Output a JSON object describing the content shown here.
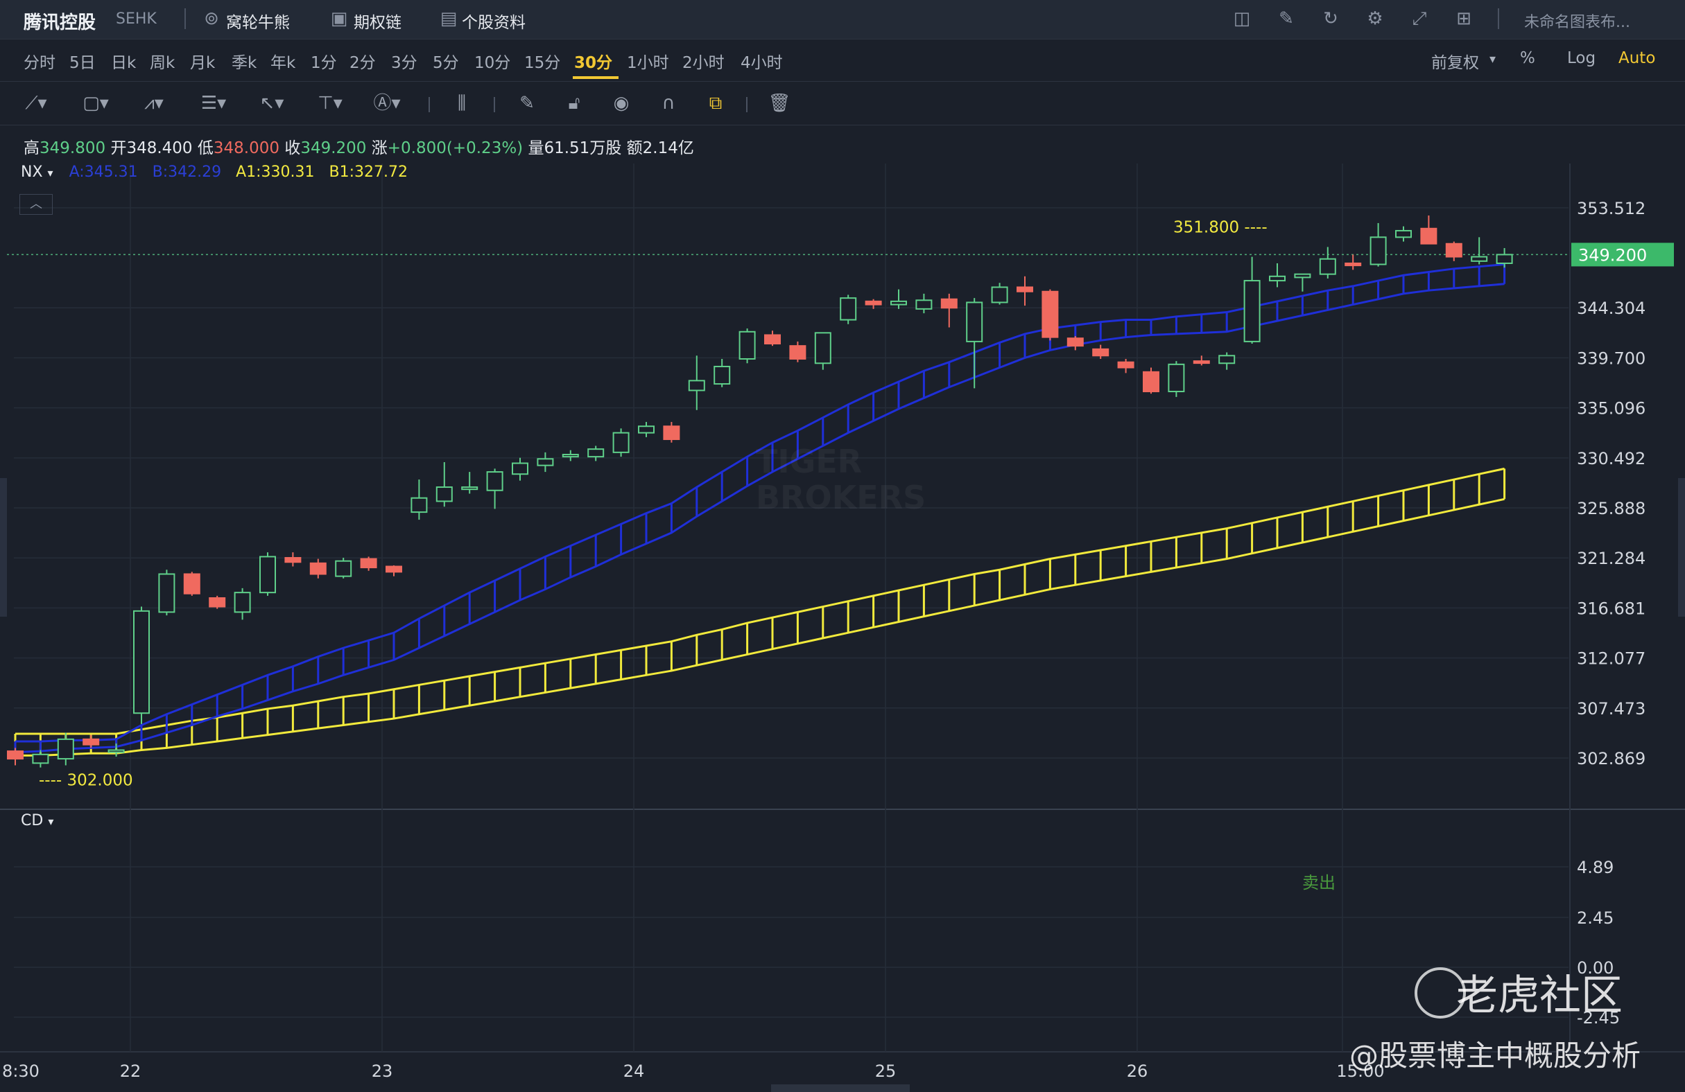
{
  "header": {
    "stock_name": "腾讯控股",
    "exchange": "SEHK",
    "items": [
      "窝轮牛熊",
      "期权链",
      "个股资料"
    ],
    "right_label": "未命名图表布..."
  },
  "periods": [
    "分时",
    "5日",
    "日k",
    "周k",
    "月k",
    "季k",
    "年k",
    "1分",
    "2分",
    "3分",
    "5分",
    "10分",
    "15分",
    "30分",
    "1小时",
    "2小时",
    "4小时"
  ],
  "active_period": "30分",
  "right_controls": {
    "adjust": "前复权",
    "percent": "%",
    "log": "Log",
    "auto": "Auto"
  },
  "quote": {
    "high_label": "高",
    "high": "349.800",
    "open_label": "开",
    "open": "348.400",
    "low_label": "低",
    "low": "348.000",
    "close_label": "收",
    "close": "349.200",
    "change_label": "涨",
    "change": "+0.800(+0.23%)",
    "volume_label": "量",
    "volume": "61.51万股",
    "amount_label": "额",
    "amount": "2.14亿"
  },
  "indicator": {
    "name": "NX",
    "a": "A:345.31",
    "b": "B:342.29",
    "a1": "A1:330.31",
    "b1": "B1:327.72"
  },
  "sub_indicator": {
    "name": "CD",
    "signal": "卖出"
  },
  "watermark": {
    "logo": "老虎社区",
    "author": "@股票博主中概股分析",
    "brand": "TIGER BROKERS"
  },
  "colors": {
    "up": "#5fd08a",
    "down": "#f06a5f",
    "band_ab": "#1f2fd8",
    "band_a1b1": "#f2ea3c",
    "last_price_bg": "#3cb96a",
    "accent": "#f2c833"
  },
  "chart_data": {
    "type": "candlestick",
    "last_price": "349.200",
    "high_annotation": "351.800",
    "low_annotation": "302.000",
    "y_ticks": [
      "353.512",
      "349.200",
      "344.304",
      "339.700",
      "335.096",
      "330.492",
      "325.888",
      "321.284",
      "316.681",
      "312.077",
      "307.473",
      "302.869"
    ],
    "x_ticks": [
      "8:30",
      "22",
      "23",
      "24",
      "25",
      "26",
      "15:00"
    ],
    "sub_y_ticks": [
      "4.89",
      "2.45",
      "0.00",
      "-2.45"
    ],
    "candles": [
      [
        303.5,
        303.8,
        302.2,
        302.8
      ],
      [
        302.4,
        303.6,
        302.0,
        303.2
      ],
      [
        302.8,
        305.2,
        302.2,
        304.6
      ],
      [
        304.6,
        305.0,
        303.8,
        304.1
      ],
      [
        303.4,
        304.2,
        303.0,
        303.6
      ],
      [
        307.0,
        316.8,
        306.0,
        316.4
      ],
      [
        316.3,
        320.2,
        316.0,
        319.8
      ],
      [
        319.8,
        320.0,
        317.8,
        318.0
      ],
      [
        317.6,
        317.8,
        316.6,
        316.8
      ],
      [
        316.3,
        318.5,
        315.6,
        318.1
      ],
      [
        318.1,
        321.8,
        317.8,
        321.4
      ],
      [
        321.3,
        321.8,
        320.5,
        320.9
      ],
      [
        320.8,
        321.2,
        319.4,
        319.8
      ],
      [
        319.6,
        321.3,
        319.4,
        321.0
      ],
      [
        321.2,
        321.4,
        320.1,
        320.4
      ],
      [
        320.5,
        320.6,
        319.6,
        320.0
      ],
      [
        325.5,
        328.5,
        324.8,
        326.8
      ],
      [
        326.5,
        330.1,
        326.0,
        327.8
      ],
      [
        327.6,
        329.2,
        327.2,
        327.8
      ],
      [
        327.5,
        329.5,
        325.8,
        329.2
      ],
      [
        329.0,
        330.5,
        328.4,
        330.0
      ],
      [
        329.8,
        331.0,
        329.2,
        330.4
      ],
      [
        330.6,
        331.2,
        330.2,
        330.8
      ],
      [
        330.6,
        331.6,
        330.2,
        331.3
      ],
      [
        331.0,
        333.2,
        330.6,
        332.8
      ],
      [
        332.8,
        333.8,
        332.4,
        333.4
      ],
      [
        333.4,
        333.8,
        331.9,
        332.2
      ],
      [
        336.7,
        339.9,
        334.9,
        337.6
      ],
      [
        337.3,
        339.6,
        337.0,
        338.9
      ],
      [
        339.6,
        342.4,
        339.2,
        342.1
      ],
      [
        341.8,
        342.2,
        340.8,
        341.0
      ],
      [
        340.8,
        341.2,
        339.3,
        339.6
      ],
      [
        339.2,
        342.0,
        338.6,
        342.0
      ],
      [
        343.2,
        345.5,
        342.8,
        345.2
      ],
      [
        344.9,
        345.1,
        344.2,
        344.6
      ],
      [
        344.6,
        346.0,
        344.2,
        344.9
      ],
      [
        344.2,
        345.6,
        343.8,
        345.0
      ],
      [
        345.1,
        345.6,
        342.5,
        344.3
      ],
      [
        341.2,
        345.2,
        336.9,
        344.8
      ],
      [
        344.8,
        346.6,
        344.6,
        346.2
      ],
      [
        346.2,
        347.2,
        344.5,
        345.8
      ],
      [
        345.8,
        346.0,
        341.3,
        341.6
      ],
      [
        341.5,
        341.7,
        340.4,
        340.8
      ],
      [
        340.5,
        340.9,
        339.6,
        339.9
      ],
      [
        339.3,
        339.6,
        338.3,
        338.8
      ],
      [
        338.4,
        338.8,
        336.4,
        336.6
      ],
      [
        336.6,
        339.4,
        336.1,
        339.1
      ],
      [
        339.4,
        339.9,
        339.0,
        339.3
      ],
      [
        339.2,
        340.2,
        338.6,
        339.9
      ],
      [
        341.2,
        349.0,
        341.0,
        346.8
      ],
      [
        346.8,
        348.4,
        346.2,
        347.2
      ],
      [
        347.1,
        347.4,
        345.8,
        347.4
      ],
      [
        347.4,
        349.9,
        347.0,
        348.8
      ],
      [
        348.4,
        349.2,
        347.8,
        348.2
      ],
      [
        348.3,
        352.1,
        348.1,
        350.8
      ],
      [
        350.8,
        351.8,
        350.4,
        351.4
      ],
      [
        351.6,
        352.8,
        350.4,
        350.2
      ],
      [
        350.2,
        350.4,
        348.6,
        349.0
      ],
      [
        348.6,
        350.8,
        348.3,
        349.0
      ],
      [
        348.4,
        349.8,
        348.0,
        349.2
      ]
    ],
    "series": [
      {
        "name": "A",
        "values": [
          304.4,
          304.4,
          304.5,
          304.5,
          304.6,
          305.9,
          306.9,
          307.8,
          308.7,
          309.6,
          310.5,
          311.3,
          312.2,
          313.0,
          313.7,
          314.4,
          315.7,
          316.9,
          318.1,
          319.2,
          320.3,
          321.4,
          322.4,
          323.4,
          324.4,
          325.4,
          326.3,
          327.8,
          329.2,
          330.6,
          331.9,
          333.0,
          334.2,
          335.4,
          336.5,
          337.5,
          338.5,
          339.3,
          340.2,
          341.1,
          341.9,
          342.4,
          342.7,
          343.0,
          343.2,
          343.2,
          343.5,
          343.7,
          343.9,
          344.4,
          344.9,
          345.4,
          345.9,
          346.3,
          346.8,
          347.3,
          347.6,
          347.9,
          348.1,
          348.3
        ]
      },
      {
        "name": "B",
        "values": [
          303.4,
          303.5,
          303.7,
          303.8,
          303.9,
          304.5,
          305.2,
          305.9,
          306.7,
          307.4,
          308.2,
          309.0,
          309.7,
          310.5,
          311.2,
          311.9,
          313.0,
          314.1,
          315.2,
          316.3,
          317.4,
          318.4,
          319.5,
          320.5,
          321.6,
          322.6,
          323.6,
          325.1,
          326.5,
          327.9,
          329.2,
          330.4,
          331.6,
          332.8,
          333.9,
          335.0,
          336.0,
          337.0,
          337.9,
          338.8,
          339.7,
          340.4,
          340.9,
          341.3,
          341.6,
          341.8,
          341.9,
          342.0,
          342.1,
          342.6,
          343.1,
          343.6,
          344.1,
          344.6,
          345.1,
          345.6,
          345.9,
          346.1,
          346.3,
          346.5
        ]
      },
      {
        "name": "A1",
        "values": [
          305.1,
          305.1,
          305.1,
          305.1,
          305.1,
          305.5,
          305.9,
          306.3,
          306.6,
          307.0,
          307.4,
          307.7,
          308.1,
          308.5,
          308.8,
          309.2,
          309.6,
          310.0,
          310.4,
          310.8,
          311.2,
          311.6,
          312.0,
          312.4,
          312.8,
          313.2,
          313.6,
          314.2,
          314.7,
          315.3,
          315.8,
          316.3,
          316.8,
          317.3,
          317.8,
          318.3,
          318.8,
          319.3,
          319.8,
          320.2,
          320.7,
          321.2,
          321.6,
          322.0,
          322.4,
          322.8,
          323.2,
          323.6,
          324.0,
          324.5,
          325.0,
          325.5,
          326.0,
          326.5,
          327.0,
          327.5,
          328.0,
          328.5,
          329.0,
          329.5
        ]
      },
      {
        "name": "B1",
        "values": [
          303.1,
          303.1,
          303.2,
          303.3,
          303.3,
          303.6,
          303.8,
          304.1,
          304.4,
          304.7,
          305.0,
          305.3,
          305.6,
          305.9,
          306.2,
          306.5,
          306.9,
          307.3,
          307.7,
          308.1,
          308.5,
          308.9,
          309.3,
          309.7,
          310.1,
          310.5,
          310.9,
          311.4,
          311.9,
          312.4,
          312.9,
          313.4,
          313.9,
          314.4,
          314.9,
          315.4,
          315.9,
          316.4,
          316.9,
          317.4,
          317.9,
          318.4,
          318.8,
          319.2,
          319.6,
          320.0,
          320.4,
          320.8,
          321.2,
          321.7,
          322.2,
          322.7,
          323.2,
          323.7,
          324.2,
          324.7,
          325.2,
          325.7,
          326.2,
          326.7
        ]
      }
    ]
  }
}
